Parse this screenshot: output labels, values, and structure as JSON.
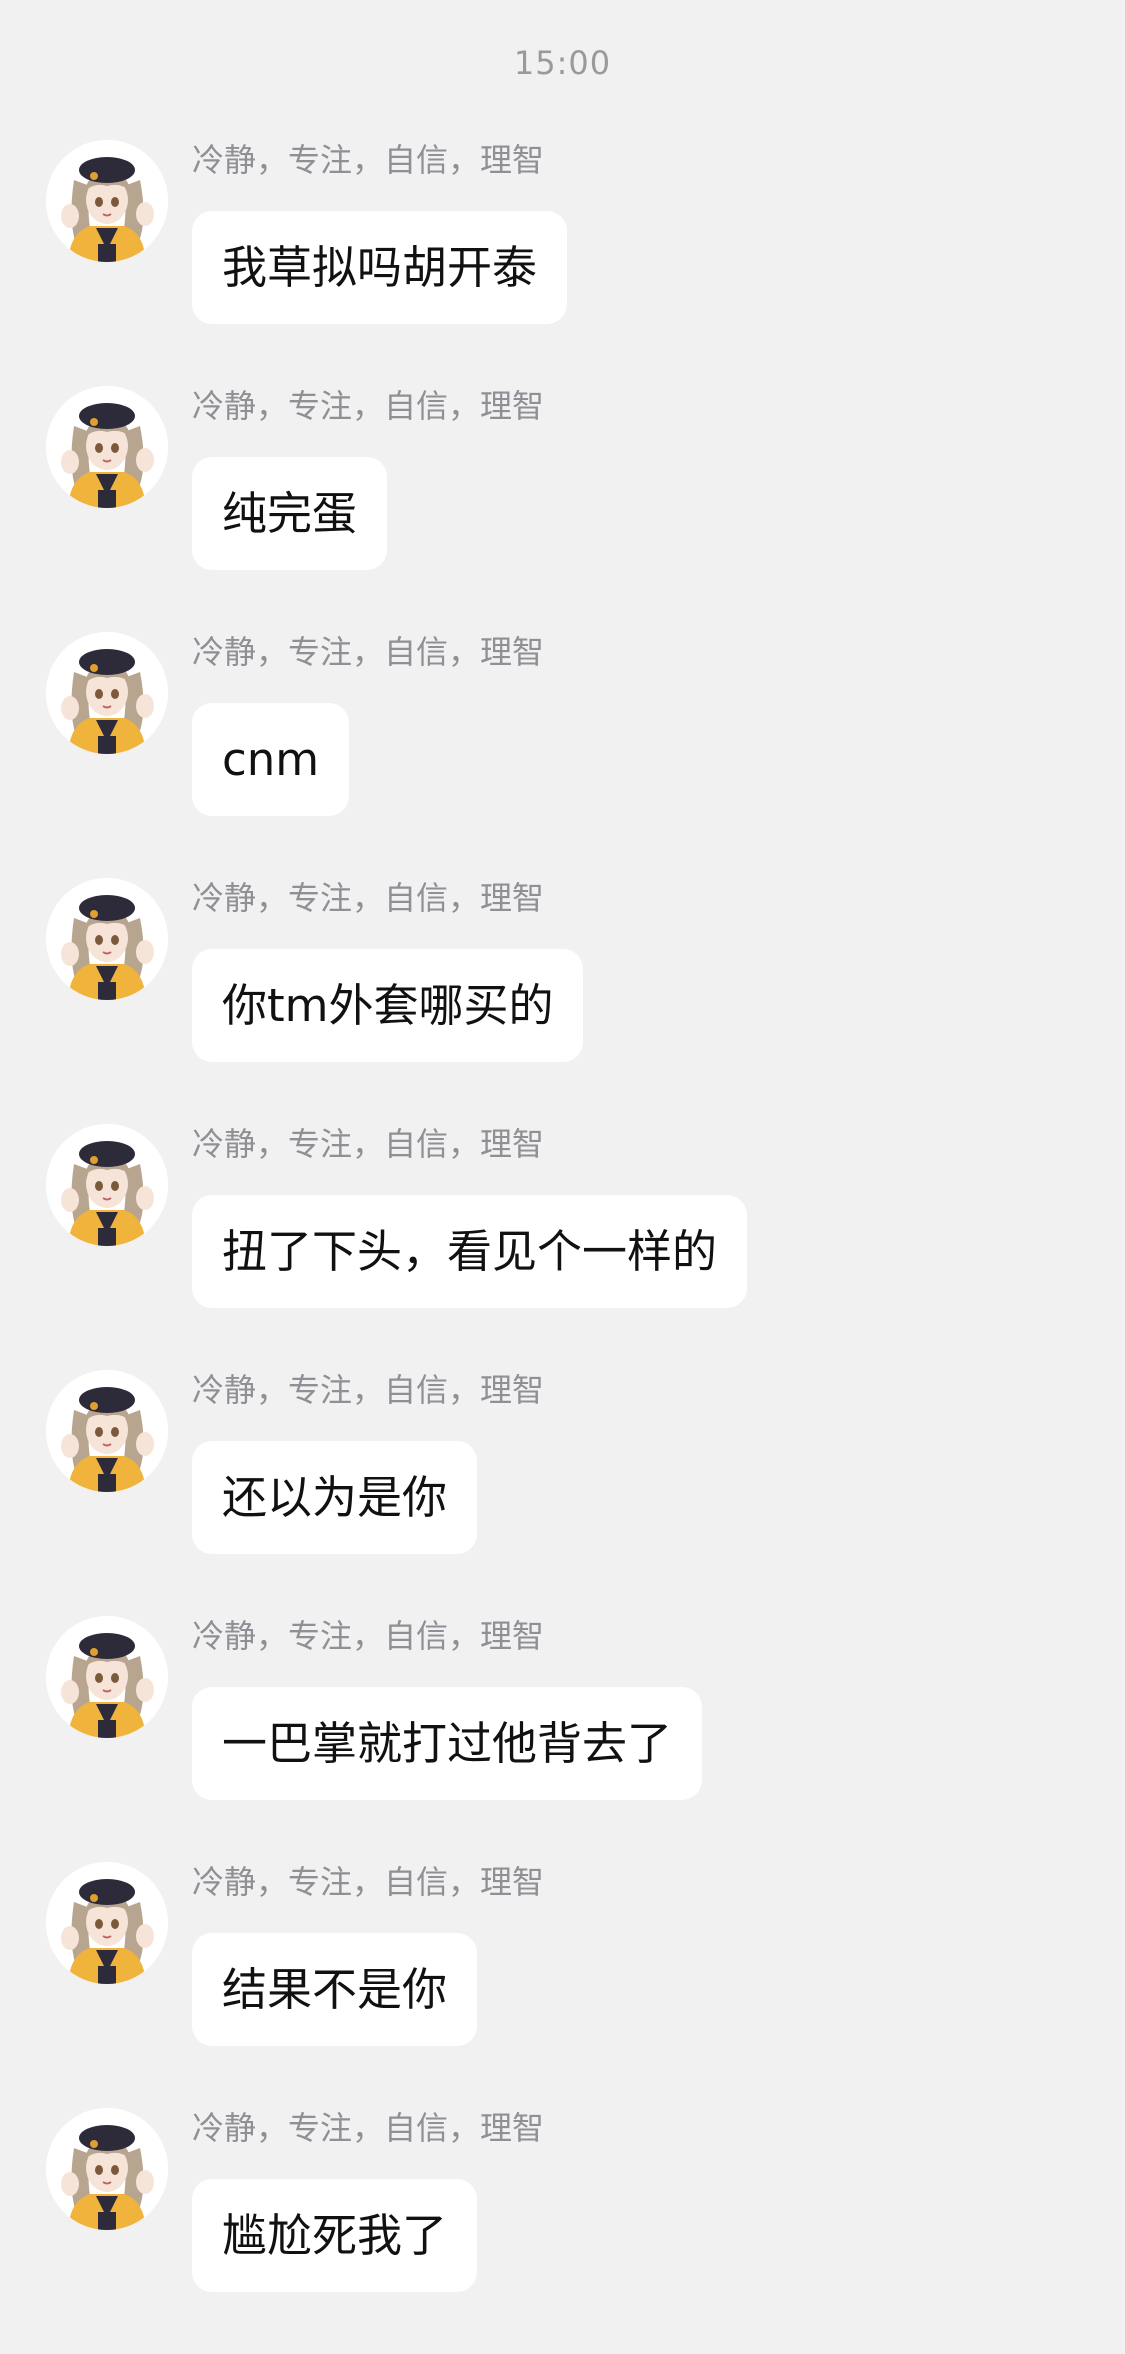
{
  "chat": {
    "timestamp": "15:00",
    "messages": [
      {
        "sender": "冷静，专注，自信，理智",
        "text": "我草拟吗胡开泰"
      },
      {
        "sender": "冷静，专注，自信，理智",
        "text": "纯完蛋"
      },
      {
        "sender": "冷静，专注，自信，理智",
        "text": "cnm"
      },
      {
        "sender": "冷静，专注，自信，理智",
        "text": "你tm外套哪买的"
      },
      {
        "sender": "冷静，专注，自信，理智",
        "text": "扭了下头，看见个一样的"
      },
      {
        "sender": "冷静，专注，自信，理智",
        "text": "还以为是你"
      },
      {
        "sender": "冷静，专注，自信，理智",
        "text": "一巴掌就打过他背去了"
      },
      {
        "sender": "冷静，专注，自信，理智",
        "text": "结果不是你"
      },
      {
        "sender": "冷静，专注，自信，理智",
        "text": "尴尬死我了"
      }
    ]
  },
  "avatar": {
    "icon": "anime-girl-avatar-icon",
    "colors": {
      "hat": "#2d2a3a",
      "hair": "#b8a58f",
      "jacket": "#f0b43c",
      "skin": "#f7e4d8",
      "accent": "#e0a030"
    }
  }
}
